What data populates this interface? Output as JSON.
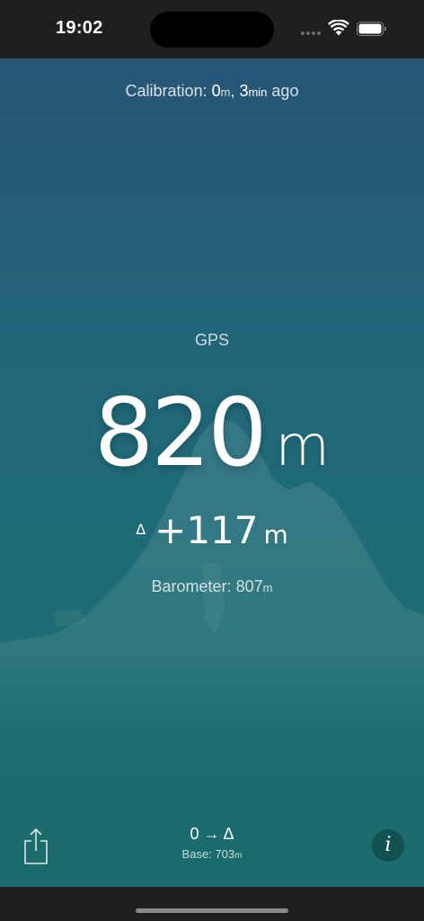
{
  "status_bar": {
    "time": "19:02"
  },
  "calibration": {
    "prefix": "Calibration: ",
    "distance_value": "0",
    "distance_unit": "m",
    "separator": ", ",
    "time_value": "3",
    "time_unit": "min",
    "suffix": " ago"
  },
  "reading": {
    "source": "GPS",
    "altitude_value": "820",
    "altitude_unit": "m",
    "delta_symbol": "Δ",
    "delta_value": "+117",
    "delta_unit": "m",
    "barometer_label": "Barometer: ",
    "barometer_value": "807",
    "barometer_unit": "m"
  },
  "bottom": {
    "mode_label": "0 → Δ",
    "base_label": "Base: ",
    "base_value": "703",
    "base_unit": "m",
    "info_label": "i",
    "share_icon": "share-icon"
  },
  "colors": {
    "gradient_top": "#275676",
    "gradient_bottom": "#1a6b6b",
    "status_bar_bg": "#1f1f1f"
  }
}
